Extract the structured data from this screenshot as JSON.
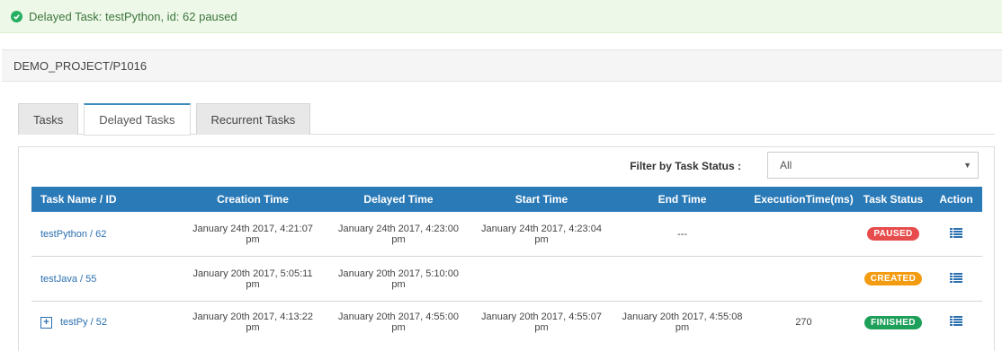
{
  "alert": {
    "message": "Delayed Task: testPython, id: 62 paused",
    "icon": "check-circle-icon",
    "color": "#3c763d"
  },
  "header": {
    "title": "DEMO_PROJECT/P1016"
  },
  "tabs": [
    {
      "label": "Tasks",
      "active": false
    },
    {
      "label": "Delayed Tasks",
      "active": true
    },
    {
      "label": "Recurrent Tasks",
      "active": false
    }
  ],
  "filter": {
    "label": "Filter by Task Status :",
    "selected": "All"
  },
  "table": {
    "columns": [
      "Task Name / ID",
      "Creation Time",
      "Delayed Time",
      "Start Time",
      "End Time",
      "ExecutionTime(ms)",
      "Task Status",
      "Action"
    ],
    "rows": [
      {
        "name": "testPython / 62",
        "creation_line1": "January 24th 2017, 4:21:07",
        "creation_line2": "pm",
        "delayed_line1": "January 24th 2017, 4:23:00",
        "delayed_line2": "pm",
        "start_line1": "January 24th 2017, 4:23:04",
        "start_line2": "pm",
        "end_line1": "---",
        "end_line2": "",
        "execution": "",
        "status": "PAUSED",
        "status_color": "#e74c4c",
        "action_icon": "list-icon"
      },
      {
        "name": "testJava / 55",
        "creation_line1": "January 20th 2017, 5:05:11",
        "creation_line2": "pm",
        "delayed_line1": "January 20th 2017, 5:10:00",
        "delayed_line2": "pm",
        "start_line1": "",
        "start_line2": "",
        "end_line1": "",
        "end_line2": "",
        "execution": "",
        "status": "CREATED",
        "status_color": "#f39c12",
        "action_icon": "list-icon"
      },
      {
        "name": "testPy / 52",
        "expand_icon": "plus-icon",
        "creation_line1": "January 20th 2017, 4:13:22",
        "creation_line2": "pm",
        "delayed_line1": "January 20th 2017, 4:55:00",
        "delayed_line2": "pm",
        "start_line1": "January 20th 2017, 4:55:07",
        "start_line2": "pm",
        "end_line1": "January 20th 2017, 4:55:08",
        "end_line2": "pm",
        "execution": "270",
        "status": "FINISHED",
        "status_color": "#1ea05a",
        "action_icon": "list-icon"
      }
    ]
  },
  "colors": {
    "table_header": "#2a7ab8",
    "link": "#2a6fb0",
    "active_tab_border": "#3c8dbc"
  }
}
